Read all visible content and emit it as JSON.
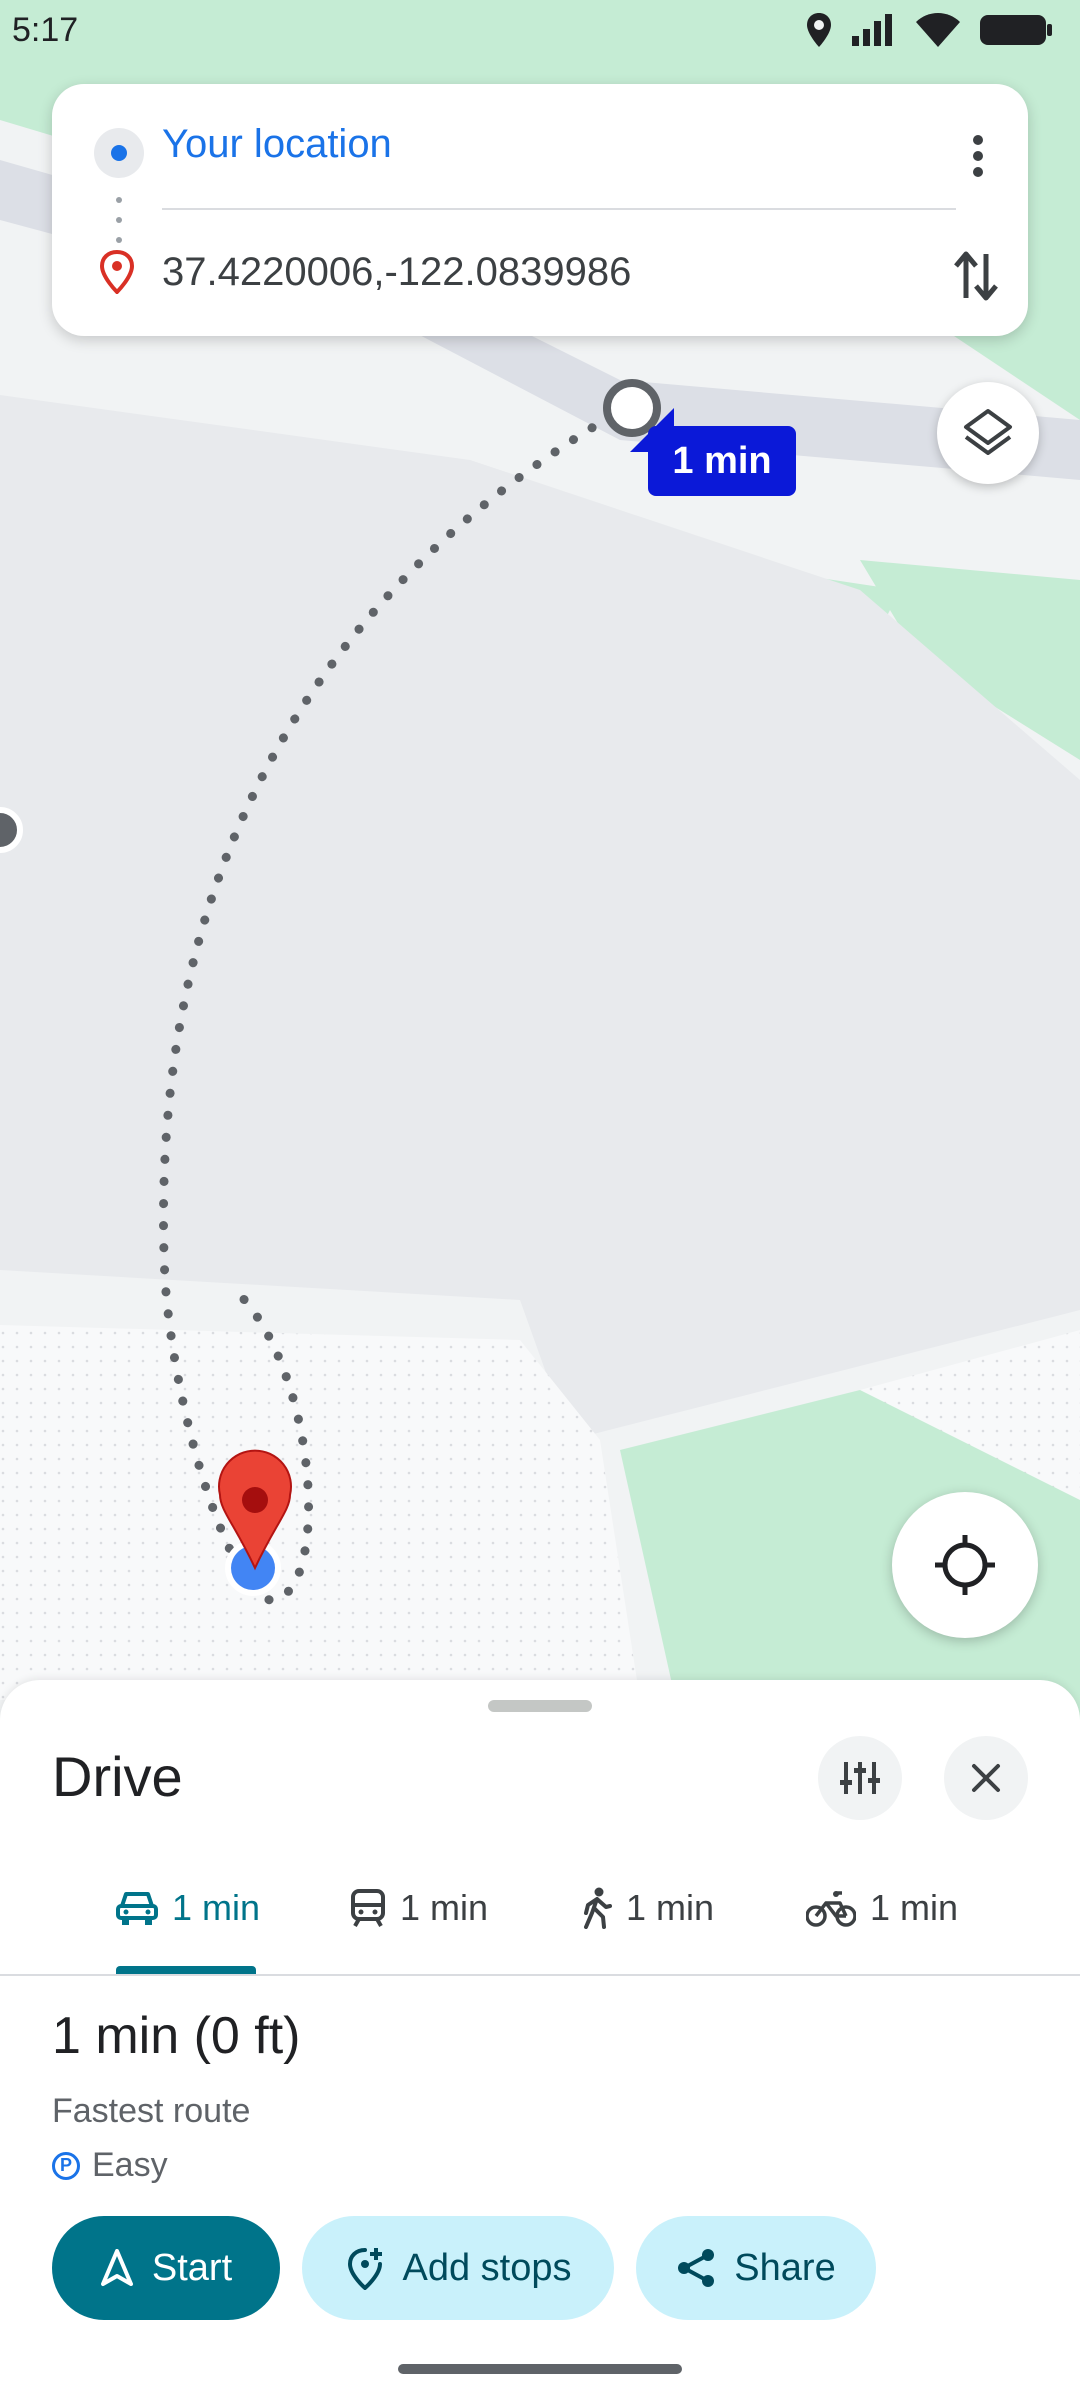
{
  "status_bar": {
    "time": "5:17"
  },
  "search": {
    "from": "Your location",
    "to": "37.4220006,-122.0839986"
  },
  "map": {
    "eta_label": "1 min"
  },
  "sheet": {
    "mode_title": "Drive",
    "tabs": [
      {
        "icon": "car-icon",
        "label": "1 min",
        "active": true
      },
      {
        "icon": "transit-icon",
        "label": "1 min",
        "active": false
      },
      {
        "icon": "walk-icon",
        "label": "1 min",
        "active": false
      },
      {
        "icon": "bike-icon",
        "label": "1 min",
        "active": false
      }
    ],
    "route_time": "1 min (0 ft)",
    "route_desc": "Fastest route",
    "parking": "Easy",
    "parking_badge": "P",
    "buttons": {
      "start": "Start",
      "add_stops": "Add stops",
      "share": "Share"
    }
  },
  "colors": {
    "accent": "#00748a",
    "blue": "#1a73e8",
    "pin_red": "#ea4335",
    "eta_bg": "#0b19d8",
    "light_button": "#c9f1fb"
  }
}
